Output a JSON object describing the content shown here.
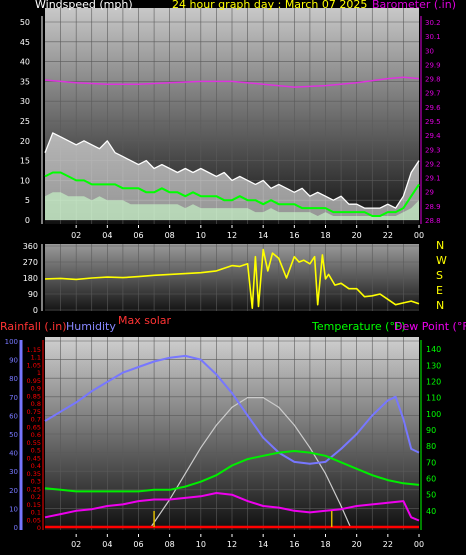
{
  "header": {
    "left_label": "Windspeed (mph)",
    "center_label": "24 hour graph day : March 07 2025",
    "right_label": "Barometer (.in)"
  },
  "labels": {
    "rainfall": "Rainfall (.in)",
    "humidity": "Humidity",
    "max_solar": "Max solar",
    "temperature": "Temperature (°F)",
    "dew_point": "Dew Point (°F)"
  },
  "colors": {
    "wind_gust": "#ffffff",
    "wind_avg": "#00ff00",
    "wind_speed": "#ffffff",
    "barometer": "#dd33dd",
    "wind_dir": "#ffff00",
    "humidity": "#7777ff",
    "temperature": "#00ee00",
    "dew_point": "#ee00ee",
    "solar": "#cccccc",
    "rainfall": "#ff0000",
    "rain_axis": "#ff0000",
    "baro_axis": "#dd00dd",
    "temp_axis": "#00ff00",
    "dir_axis": "#ffff00"
  },
  "chart_data": [
    {
      "type": "line",
      "title": "24 hour graph day : March 07 2025",
      "x_ticks": [
        "02",
        "04",
        "06",
        "08",
        "10",
        "12",
        "14",
        "16",
        "18",
        "20",
        "22",
        "00"
      ],
      "xlim": [
        0,
        24
      ],
      "ylabel": "Windspeed (mph)",
      "ylim": [
        0,
        50
      ],
      "y_ticks": [
        0,
        5,
        10,
        15,
        20,
        25,
        30,
        35,
        40,
        45,
        50
      ],
      "y2label": "Barometer (.in)",
      "y2lim": [
        28.8,
        30.2
      ],
      "y2_ticks": [
        "28.8",
        "28.9",
        "29",
        "29.1",
        "29.2",
        "29.3",
        "29.4",
        "29.5",
        "29.6",
        "29.7",
        "29.8",
        "29.9",
        "30",
        "30.1",
        "30.2"
      ],
      "series": [
        {
          "name": "Wind gust",
          "x": [
            0,
            0.5,
            1,
            1.5,
            2,
            2.5,
            3,
            3.5,
            4,
            4.5,
            5,
            5.5,
            6,
            6.5,
            7,
            7.5,
            8,
            8.5,
            9,
            9.5,
            10,
            10.5,
            11,
            11.5,
            12,
            12.5,
            13,
            13.5,
            14,
            14.5,
            15,
            15.5,
            16,
            16.5,
            17,
            17.5,
            18,
            18.5,
            19,
            19.5,
            20,
            20.5,
            21,
            21.5,
            22,
            22.5,
            23,
            23.5,
            24
          ],
          "y": [
            17,
            22,
            21,
            20,
            19,
            20,
            19,
            18,
            20,
            17,
            16,
            15,
            14,
            15,
            13,
            14,
            13,
            12,
            13,
            12,
            13,
            12,
            11,
            12,
            10,
            11,
            10,
            9,
            10,
            8,
            9,
            8,
            7,
            8,
            6,
            7,
            6,
            5,
            6,
            4,
            4,
            3,
            3,
            3,
            4,
            3,
            6,
            12,
            15
          ]
        },
        {
          "name": "Wind average",
          "x": [
            0,
            0.5,
            1,
            1.5,
            2,
            2.5,
            3,
            3.5,
            4,
            4.5,
            5,
            5.5,
            6,
            6.5,
            7,
            7.5,
            8,
            8.5,
            9,
            9.5,
            10,
            10.5,
            11,
            11.5,
            12,
            12.5,
            13,
            13.5,
            14,
            14.5,
            15,
            15.5,
            16,
            16.5,
            17,
            17.5,
            18,
            18.5,
            19,
            19.5,
            20,
            20.5,
            21,
            21.5,
            22,
            22.5,
            23,
            23.5,
            24
          ],
          "y": [
            11,
            12,
            12,
            11,
            10,
            10,
            9,
            9,
            9,
            9,
            8,
            8,
            8,
            7,
            7,
            8,
            7,
            7,
            6,
            7,
            6,
            6,
            6,
            5,
            5,
            6,
            5,
            5,
            4,
            5,
            4,
            4,
            4,
            3,
            3,
            3,
            3,
            2,
            2,
            2,
            2,
            2,
            1,
            1,
            2,
            2,
            3,
            6,
            9
          ]
        },
        {
          "name": "Wind speed",
          "x": [
            0,
            0.5,
            1,
            1.5,
            2,
            2.5,
            3,
            3.5,
            4,
            4.5,
            5,
            5.5,
            6,
            6.5,
            7,
            7.5,
            8,
            8.5,
            9,
            9.5,
            10,
            10.5,
            11,
            11.5,
            12,
            12.5,
            13,
            13.5,
            14,
            14.5,
            15,
            15.5,
            16,
            16.5,
            17,
            17.5,
            18,
            18.5,
            19,
            19.5,
            20,
            20.5,
            21,
            21.5,
            22,
            22.5,
            23,
            23.5,
            24
          ],
          "y": [
            6,
            7,
            7,
            6,
            6,
            6,
            5,
            6,
            5,
            5,
            5,
            4,
            4,
            4,
            4,
            4,
            4,
            4,
            3,
            4,
            3,
            3,
            3,
            3,
            3,
            3,
            3,
            2,
            2,
            3,
            2,
            2,
            2,
            2,
            2,
            1,
            2,
            1,
            1,
            1,
            1,
            1,
            1,
            1,
            1,
            1,
            2,
            3,
            5
          ]
        },
        {
          "name": "Barometer",
          "axis": "right",
          "x": [
            0,
            2,
            4,
            6,
            8,
            10,
            12,
            14,
            16,
            18,
            20,
            22,
            23,
            24
          ],
          "y": [
            29.79,
            29.77,
            29.76,
            29.76,
            29.77,
            29.78,
            29.78,
            29.76,
            29.74,
            29.75,
            29.77,
            29.8,
            29.81,
            29.8
          ]
        }
      ]
    },
    {
      "type": "line",
      "title": "",
      "x_ticks": [
        "02",
        "04",
        "06",
        "08",
        "10",
        "12",
        "14",
        "16",
        "18",
        "20",
        "22",
        "00"
      ],
      "xlim": [
        0,
        24
      ],
      "ylabel": "",
      "ylim": [
        0,
        360
      ],
      "y_ticks": [
        0,
        90,
        180,
        270,
        360
      ],
      "compass_labels": [
        "N",
        "W",
        "S",
        "E",
        "N"
      ],
      "series": [
        {
          "name": "Wind direction",
          "x": [
            0,
            1,
            2,
            3,
            4,
            5,
            6,
            7,
            8,
            9,
            10,
            11,
            11.5,
            12,
            12.5,
            13,
            13.3,
            13.5,
            13.7,
            14,
            14.3,
            14.6,
            15,
            15.5,
            16,
            16.3,
            16.6,
            17,
            17.3,
            17.5,
            17.8,
            18,
            18.2,
            18.6,
            19,
            19.5,
            20,
            20.5,
            21,
            21.5,
            22,
            22.5,
            23,
            23.5,
            24
          ],
          "y": [
            175,
            178,
            172,
            180,
            185,
            182,
            188,
            195,
            200,
            205,
            210,
            220,
            235,
            250,
            245,
            260,
            10,
            300,
            20,
            340,
            220,
            320,
            290,
            180,
            300,
            270,
            280,
            260,
            300,
            30,
            310,
            175,
            200,
            140,
            150,
            120,
            120,
            75,
            80,
            90,
            60,
            30,
            40,
            50,
            35
          ]
        }
      ]
    },
    {
      "type": "line",
      "title": "",
      "x_ticks": [
        "02",
        "04",
        "06",
        "08",
        "10",
        "12",
        "14",
        "16",
        "18",
        "20",
        "22",
        "00"
      ],
      "xlim": [
        0,
        24
      ],
      "ylabel": "Humidity",
      "ylim": [
        0,
        100
      ],
      "y_ticks": [
        0,
        10,
        20,
        30,
        40,
        50,
        60,
        70,
        80,
        90,
        100
      ],
      "rain_label": "Rainfall (.in)",
      "rain_lim": [
        0,
        1.2
      ],
      "rain_ticks": [
        "0",
        "0.05",
        "0.1",
        "0.15",
        "0.2",
        "0.25",
        "0.3",
        "0.35",
        "0.4",
        "0.45",
        "0.5",
        "0.55",
        "0.6",
        "0.65",
        "0.7",
        "0.75",
        "0.8",
        "0.85",
        "0.9",
        "0.95",
        "1",
        "1.05",
        "1.1",
        "1.15"
      ],
      "y2label": "Temperature (°F)",
      "y2lim": [
        30,
        145
      ],
      "y2_ticks": [
        40,
        50,
        60,
        70,
        80,
        90,
        100,
        110,
        120,
        130,
        140
      ],
      "series": [
        {
          "name": "Humidity",
          "x": [
            0,
            1,
            2,
            3,
            4,
            5,
            6,
            7,
            8,
            9,
            10,
            11,
            12,
            13,
            14,
            15,
            16,
            17,
            18,
            19,
            20,
            21,
            22,
            22.5,
            23,
            23.5,
            24
          ],
          "y": [
            57,
            62,
            67,
            73,
            78,
            83,
            86,
            89,
            91,
            92,
            90,
            82,
            72,
            60,
            48,
            40,
            35,
            34,
            35,
            42,
            50,
            60,
            68,
            70,
            58,
            42,
            40
          ]
        },
        {
          "name": "Temperature",
          "axis": "right",
          "x": [
            0,
            1,
            2,
            3,
            4,
            5,
            6,
            7,
            8,
            9,
            10,
            11,
            12,
            13,
            14,
            15,
            16,
            17,
            18,
            19,
            20,
            21,
            22,
            23,
            24
          ],
          "y": [
            54,
            53,
            52,
            52,
            52,
            52,
            52,
            53,
            53,
            55,
            58,
            62,
            68,
            72,
            74,
            76,
            77,
            76,
            74,
            70,
            66,
            62,
            59,
            57,
            56
          ]
        },
        {
          "name": "Dew Point",
          "axis": "right",
          "x": [
            0,
            1,
            2,
            3,
            4,
            5,
            6,
            7,
            8,
            9,
            10,
            11,
            12,
            13,
            14,
            15,
            16,
            17,
            18,
            19,
            20,
            21,
            22,
            23,
            23.5,
            24
          ],
          "y": [
            36,
            38,
            40,
            41,
            43,
            44,
            46,
            47,
            47,
            48,
            49,
            51,
            50,
            46,
            43,
            42,
            40,
            39,
            40,
            41,
            43,
            44,
            45,
            46,
            36,
            34
          ]
        },
        {
          "name": "Max solar",
          "axis": "right",
          "x": [
            6.8,
            8,
            9,
            10,
            11,
            12,
            13,
            14,
            15,
            16,
            17,
            18,
            19,
            19.6
          ],
          "y": [
            30,
            47,
            63,
            79,
            93,
            104,
            110,
            110,
            104,
            93,
            79,
            63,
            43,
            30
          ]
        },
        {
          "name": "Rainfall",
          "axis": "rain",
          "x": [
            0,
            24
          ],
          "y": [
            0,
            0
          ]
        }
      ],
      "markers_x": [
        7,
        18.4
      ]
    }
  ]
}
